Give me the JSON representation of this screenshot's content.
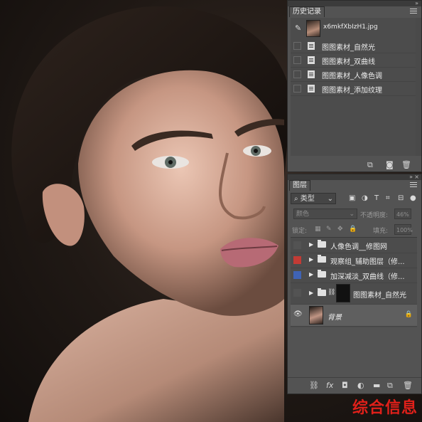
{
  "history_panel": {
    "tab_label": "历史记录",
    "snapshot_name": "x6mkfXbIzH1.jpg",
    "items": [
      {
        "label": "图图素材_自然光"
      },
      {
        "label": "图图素材_双曲线"
      },
      {
        "label": "图图素材_人像色调"
      },
      {
        "label": "图图素材_添加纹理"
      }
    ]
  },
  "layers_panel": {
    "tab_label": "图层",
    "filter_label": "类型",
    "blend_mode": "颜色",
    "opacity_label": "不透明度:",
    "opacity_value": "46%",
    "lock_label": "锁定:",
    "fill_label": "填充:",
    "fill_value": "100%",
    "layers": [
      {
        "name": "人像色调__修图网",
        "color": "#535353"
      },
      {
        "name": "观察组_辅助图层（修...",
        "color": "#c23b35"
      },
      {
        "name": "加深减淡_双曲线（修...",
        "color": "#3f63b5"
      },
      {
        "name": "图图素材_自然光",
        "color": "#535353"
      },
      {
        "name": "背景",
        "color": "#535353"
      }
    ]
  },
  "watermark": {
    "text": "综合信息"
  },
  "colors": {
    "panel_bg": "#535353",
    "panel_border": "#2b2b2b",
    "watermark": "#e0201a"
  }
}
